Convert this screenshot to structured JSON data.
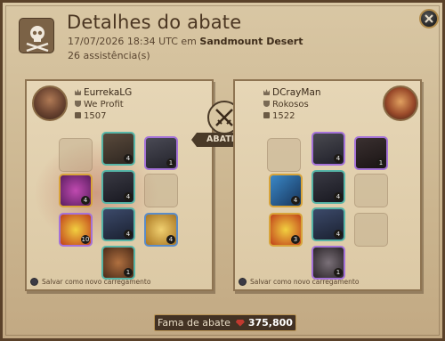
{
  "header": {
    "title": "Detalhes do abate",
    "date": "17/07/2026 18:34 UTC",
    "location_prefix": "em",
    "location": "Sandmount Desert",
    "assists": "26 assistência(s)"
  },
  "killer": {
    "name": "EurrekaLG",
    "guild": "We Profit",
    "item_power": "1507",
    "save_label": "Salvar como novo carregamento",
    "slots": [
      {
        "name": "bag-slot",
        "filled": false,
        "level": ""
      },
      {
        "name": "head-slot",
        "filled": true,
        "level": "4"
      },
      {
        "name": "cape-slot",
        "filled": true,
        "level": "1"
      },
      {
        "name": "mainhand-slot",
        "filled": true,
        "level": "4"
      },
      {
        "name": "armor-slot",
        "filled": true,
        "level": "4"
      },
      {
        "name": "offhand-slot",
        "filled": false,
        "level": ""
      },
      {
        "name": "potion-slot",
        "filled": true,
        "level": "10"
      },
      {
        "name": "shoes-slot",
        "filled": true,
        "level": "4"
      },
      {
        "name": "food-slot",
        "filled": true,
        "level": "4"
      },
      {
        "name": "mount-slot",
        "filled": true,
        "level": "1"
      }
    ]
  },
  "victim": {
    "name": "DCrayMan",
    "guild": "Rokosos",
    "item_power": "1522",
    "save_label": "Salvar como novo carregamento",
    "slots": [
      {
        "name": "bag-slot",
        "filled": false,
        "level": ""
      },
      {
        "name": "head-slot",
        "filled": true,
        "level": "4"
      },
      {
        "name": "cape-slot",
        "filled": true,
        "level": "1"
      },
      {
        "name": "mainhand-slot",
        "filled": true,
        "level": "4"
      },
      {
        "name": "armor-slot",
        "filled": true,
        "level": "4"
      },
      {
        "name": "offhand-slot",
        "filled": false,
        "level": ""
      },
      {
        "name": "potion-slot",
        "filled": true,
        "level": "3"
      },
      {
        "name": "shoes-slot",
        "filled": true,
        "level": "4"
      },
      {
        "name": "food-slot",
        "filled": false,
        "level": ""
      },
      {
        "name": "mount-slot",
        "filled": true,
        "level": "1"
      }
    ]
  },
  "versus": {
    "icon": "crossed-swords-icon",
    "label": "ABATEU"
  },
  "fame": {
    "label": "Fama de abate",
    "value": "375,800",
    "icon": "fame-gem-icon"
  },
  "colors": {
    "accent": "#4a3a28",
    "fame_gem": "#c2392f",
    "blood": "#aa3c32"
  }
}
